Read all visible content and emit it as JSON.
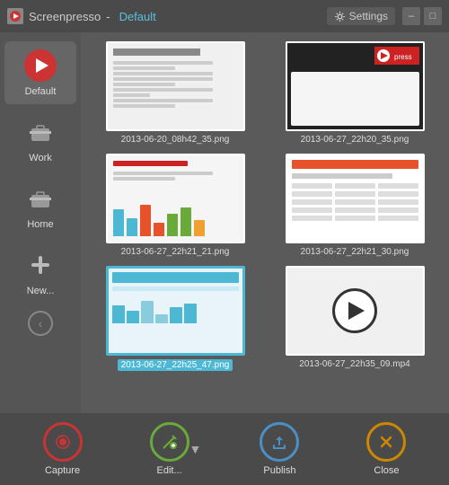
{
  "titleBar": {
    "icon": "screenpresso-icon",
    "title": "Screenpresso",
    "separator": "-",
    "profile": "Default",
    "settingsLabel": "Settings",
    "minimizeLabel": "–",
    "maximizeLabel": "□"
  },
  "sidebar": {
    "items": [
      {
        "id": "default",
        "label": "Default",
        "active": true
      },
      {
        "id": "work",
        "label": "Work"
      },
      {
        "id": "home",
        "label": "Home"
      },
      {
        "id": "new",
        "label": "New..."
      }
    ]
  },
  "gallery": {
    "items": [
      {
        "id": 1,
        "label": "2013-06-20_08h42_35.png",
        "type": "doc",
        "selected": false
      },
      {
        "id": 2,
        "label": "2013-06-27_22h20_35.png",
        "type": "brand",
        "selected": false
      },
      {
        "id": 3,
        "label": "2013-06-27_22h21_21.png",
        "type": "chart",
        "selected": false
      },
      {
        "id": 4,
        "label": "2013-06-27_22h21_30.png",
        "type": "form",
        "selected": false
      },
      {
        "id": 5,
        "label": "2013-06-27_22h25_47.png",
        "type": "blue",
        "selected": true
      },
      {
        "id": 6,
        "label": "2013-06-27_22h35_09.mp4",
        "type": "video",
        "selected": false
      }
    ]
  },
  "toolbar": {
    "captureLabel": "Capture",
    "editLabel": "Edit...",
    "publishLabel": "Publish",
    "closeLabel": "Close"
  }
}
